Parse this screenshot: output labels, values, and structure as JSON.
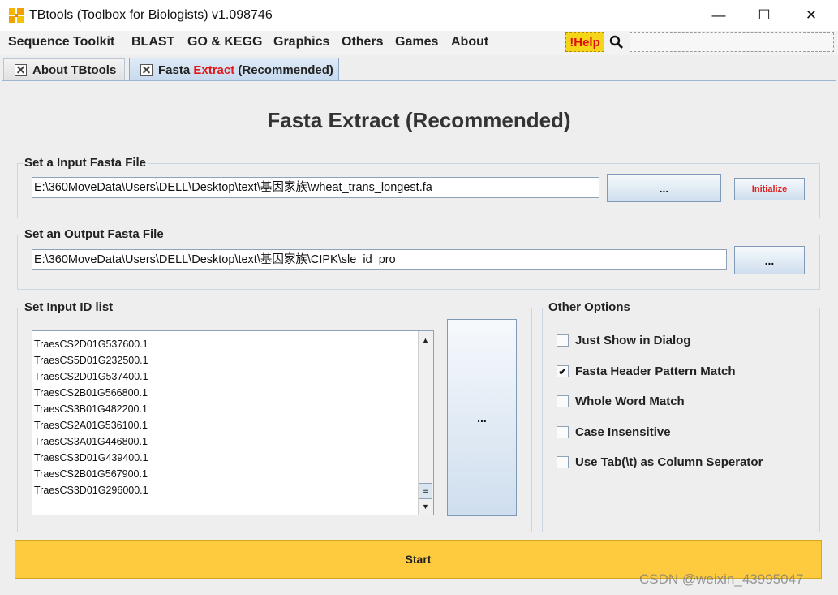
{
  "window": {
    "title": "TBtools (Toolbox for Biologists) v1.098746",
    "minimize": "—",
    "maximize": "☐",
    "close": "✕"
  },
  "menu": {
    "items": [
      "Sequence Toolkit",
      "BLAST",
      "GO & KEGG",
      "Graphics",
      "Others",
      "Games",
      "About"
    ],
    "help_label": "!Help",
    "search_value": ""
  },
  "tabs": {
    "about": "About TBtools",
    "fasta_prefix": "Fasta ",
    "fasta_highlight": "Extract",
    "fasta_suffix": " (Recommended)",
    "active": "fasta"
  },
  "main": {
    "title": "Fasta Extract (Recommended)",
    "input_section": {
      "title": "Set a Input Fasta File",
      "path": "E:\\360MoveData\\Users\\DELL\\Desktop\\text\\基因家族\\wheat_trans_longest.fa",
      "browse_label": "...",
      "initialize_label": "Initialize"
    },
    "output_section": {
      "title": "Set an Output Fasta File",
      "path": "E:\\360MoveData\\Users\\DELL\\Desktop\\text\\基因家族\\CIPK\\sle_id_pro",
      "browse_label": "..."
    },
    "id_section": {
      "title": "Set Input ID list",
      "ids": [
        "TraesCS2D01G537600.1",
        "TraesCS5D01G232500.1",
        "TraesCS2D01G537400.1",
        "TraesCS2B01G566800.1",
        "TraesCS3B01G482200.1",
        "TraesCS2A01G536100.1",
        "TraesCS3A01G446800.1",
        "TraesCS3D01G439400.1",
        "TraesCS2B01G567900.1",
        "TraesCS3D01G296000.1"
      ],
      "browse_label": "..."
    },
    "options": {
      "title": "Other Options",
      "items": [
        {
          "label": "Just Show in Dialog",
          "checked": false
        },
        {
          "label": "Fasta Header Pattern Match",
          "checked": true
        },
        {
          "label": "Whole Word Match",
          "checked": false
        },
        {
          "label": "Case Insensitive",
          "checked": false
        },
        {
          "label": "Use Tab(\\t) as Column Seperator",
          "checked": false
        }
      ]
    },
    "start_label": "Start"
  },
  "watermark": "CSDN @weixin_43995047",
  "colors": {
    "accent_yellow": "#fecb3e",
    "help_yellow": "#f5d51a",
    "highlight_red": "#e01818",
    "tab_active": "#c6d9ee"
  }
}
